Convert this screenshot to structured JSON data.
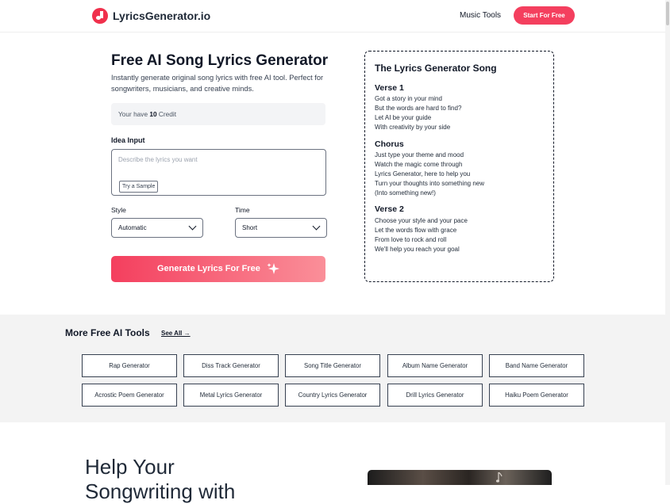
{
  "header": {
    "logo_text": "LyricsGenerator.io",
    "nav_link": "Music Tools",
    "cta_label": "Start For Free"
  },
  "form": {
    "title": "Free AI Song Lyrics Generator",
    "subtitle": "Instantly generate original song lyrics with free AI tool. Perfect for songwriters, musicians, and creative minds.",
    "credit_prefix": "Your have",
    "credit_count": "10",
    "credit_suffix": "Credit",
    "idea_label": "Idea Input",
    "idea_placeholder": "Describe the lyrics you want",
    "sample_button": "Try a Sample",
    "style_label": "Style",
    "style_value": "Automatic",
    "time_label": "Time",
    "time_value": "Short",
    "generate_label": "Generate Lyrics For Free"
  },
  "song": {
    "title": "The Lyrics Generator Song",
    "verse1_title": "Verse 1",
    "verse1": [
      "Got a story in your mind",
      "But the words are hard to find?",
      "Let AI be your guide",
      "With creativity by your side"
    ],
    "chorus_title": "Chorus",
    "chorus": [
      "Just type your theme and mood",
      "Watch the magic come through",
      "Lyrics Generator, here to help you",
      "Turn your thoughts into something new",
      "(Into something new!)"
    ],
    "verse2_title": "Verse 2",
    "verse2": [
      "Choose your style and your pace",
      "Let the words flow with grace",
      "From love to rock and roll",
      "We'll help you reach your goal"
    ]
  },
  "tools": {
    "heading": "More Free AI Tools",
    "see_all": "See All →",
    "items": [
      "Rap Generator",
      "Diss Track Generator",
      "Song Title Generator",
      "Album Name Generator",
      "Band Name Generator",
      "Acrostic Poem Generator",
      "Metal Lyrics Generator",
      "Country Lyrics Generator",
      "Drill Lyrics Generator",
      "Haiku Poem Generator"
    ]
  },
  "bottom": {
    "heading_line1": "Help Your",
    "heading_line2": "Songwriting with"
  },
  "colors": {
    "brand": "#f43f5e",
    "gradient_end": "#fa8f99",
    "section_bg": "#f3f3f3"
  }
}
